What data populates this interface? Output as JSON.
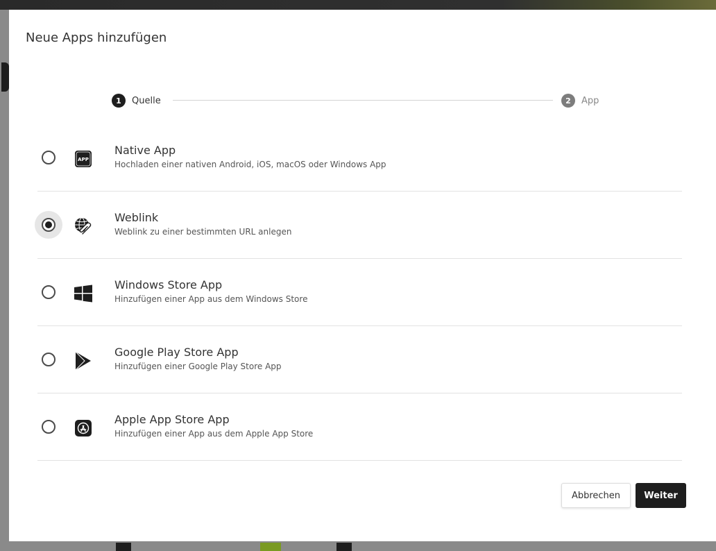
{
  "dialog": {
    "title": "Neue Apps hinzufügen"
  },
  "stepper": {
    "steps": [
      {
        "number": "1",
        "label": "Quelle",
        "state": "active"
      },
      {
        "number": "2",
        "label": "App",
        "state": "inactive"
      }
    ]
  },
  "options": [
    {
      "icon": "app-badge-icon",
      "title": "Native App",
      "description": "Hochladen einer nativen Android, iOS, macOS oder Windows App",
      "icon_text": "APP",
      "selected": false
    },
    {
      "icon": "globe-paperclip-icon",
      "title": "Weblink",
      "description": "Weblink zu einer bestimmten URL anlegen",
      "selected": true
    },
    {
      "icon": "windows-logo-icon",
      "title": "Windows Store App",
      "description": "Hinzufügen einer App aus dem Windows Store",
      "selected": false
    },
    {
      "icon": "play-store-icon",
      "title": "Google Play Store App",
      "description": "Hinzufügen einer Google Play Store App",
      "selected": false
    },
    {
      "icon": "app-store-icon",
      "title": "Apple App Store App",
      "description": "Hinzufügen einer App aus dem Apple App Store",
      "selected": false
    }
  ],
  "footer": {
    "cancel_label": "Abbrechen",
    "next_label": "Weiter"
  },
  "colors": {
    "primary": "#1e1e1e",
    "selected_bg": "#e6e6e6",
    "divider": "#e2e2e2"
  }
}
